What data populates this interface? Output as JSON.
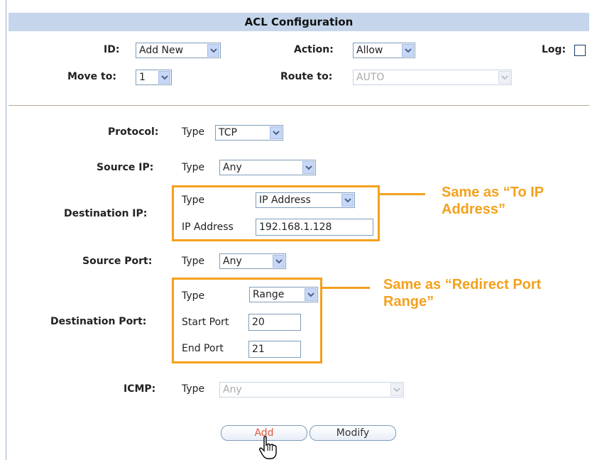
{
  "header": {
    "title": "ACL Configuration"
  },
  "top": {
    "id_label": "ID:",
    "id_value": "Add New",
    "action_label": "Action:",
    "action_value": "Allow",
    "log_label": "Log:",
    "move_label": "Move to:",
    "move_value": "1",
    "route_label": "Route to:",
    "route_value": "AUTO"
  },
  "protocol": {
    "label": "Protocol:",
    "type_label": "Type",
    "value": "TCP"
  },
  "source_ip": {
    "label": "Source IP:",
    "type_label": "Type",
    "value": "Any"
  },
  "dest_ip": {
    "label": "Destination IP:",
    "type_label": "Type",
    "type_value": "IP Address",
    "addr_label": "IP Address",
    "addr_value": "192.168.1.128",
    "note": "Same as “To IP Address”"
  },
  "source_port": {
    "label": "Source Port:",
    "type_label": "Type",
    "value": "Any"
  },
  "dest_port": {
    "label": "Destination Port:",
    "type_label": "Type",
    "type_value": "Range",
    "start_label": "Start Port",
    "start_value": "20",
    "end_label": "End Port",
    "end_value": "21",
    "note": "Same as “Redirect Port Range”"
  },
  "icmp": {
    "label": "ICMP:",
    "type_label": "Type",
    "value": "Any"
  },
  "buttons": {
    "add": "Add",
    "modify": "Modify"
  },
  "colors": {
    "header_bg": "#c5d6ec",
    "highlight": "#f4a11c"
  }
}
